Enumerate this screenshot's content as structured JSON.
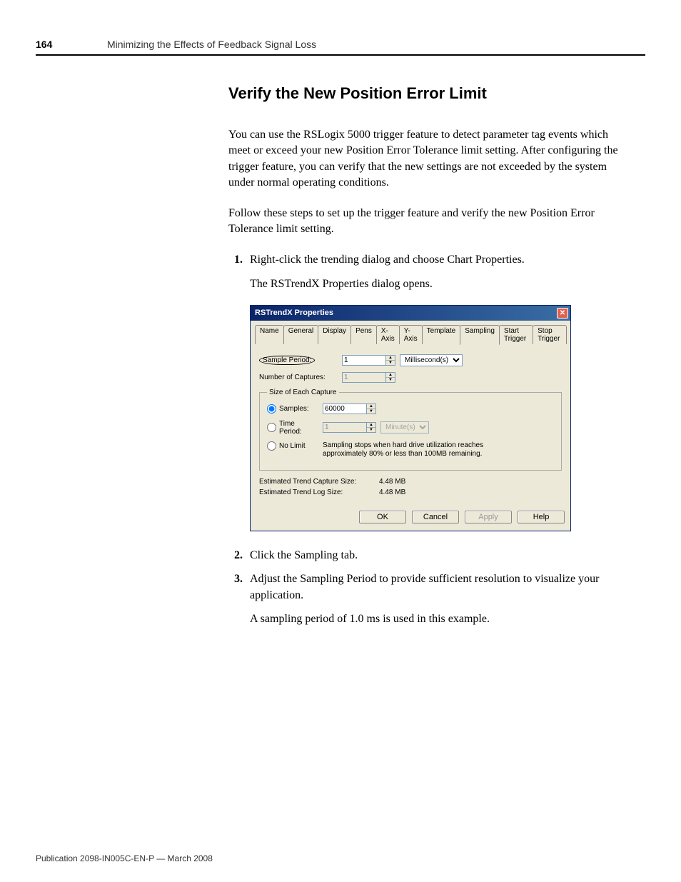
{
  "header": {
    "page_number": "164",
    "running_head": "Minimizing the Effects of Feedback Signal Loss"
  },
  "section_title": "Verify the New Position Error Limit",
  "paragraphs": {
    "intro1": "You can use the RSLogix 5000 trigger feature to detect parameter tag events which meet or exceed your new Position Error Tolerance limit setting. After configuring the trigger feature, you can verify that the new settings are not exceeded by the system under normal operating conditions.",
    "intro2": "Follow these steps to set up the trigger feature and verify the new Position Error Tolerance limit setting."
  },
  "steps": {
    "s1_num": "1.",
    "s1_text": "Right-click the trending dialog and choose Chart Properties.",
    "s1_sub": "The RSTrendX Properties dialog opens.",
    "s2_num": "2.",
    "s2_text": "Click the Sampling tab.",
    "s3_num": "3.",
    "s3_text": "Adjust the Sampling Period to provide sufficient resolution to visualize your application.",
    "s3_sub": "A sampling period of 1.0 ms is used in this example."
  },
  "dialog": {
    "title": "RSTrendX Properties",
    "tabs": [
      "Name",
      "General",
      "Display",
      "Pens",
      "X-Axis",
      "Y-Axis",
      "Template",
      "Sampling",
      "Start Trigger",
      "Stop Trigger"
    ],
    "active_tab": "Sampling",
    "sample_period_label": "Sample Period:",
    "sample_period_value": "1",
    "sample_period_unit": "Millisecond(s)",
    "num_captures_label": "Number of Captures:",
    "num_captures_value": "1",
    "group_title": "Size of Each Capture",
    "radio_samples": "Samples:",
    "samples_value": "60000",
    "radio_time": "Time Period:",
    "time_value": "1",
    "time_unit": "Minute(s)",
    "radio_nolimit": "No Limit",
    "nolimit_note": "Sampling stops when hard drive utilization reaches approximately 80% or less than 100MB remaining.",
    "est_capture_label": "Estimated Trend Capture Size:",
    "est_capture_value": "4.48 MB",
    "est_log_label": "Estimated Trend Log Size:",
    "est_log_value": "4.48 MB",
    "buttons": {
      "ok": "OK",
      "cancel": "Cancel",
      "apply": "Apply",
      "help": "Help"
    }
  },
  "footer": "Publication 2098-IN005C-EN-P — March 2008"
}
